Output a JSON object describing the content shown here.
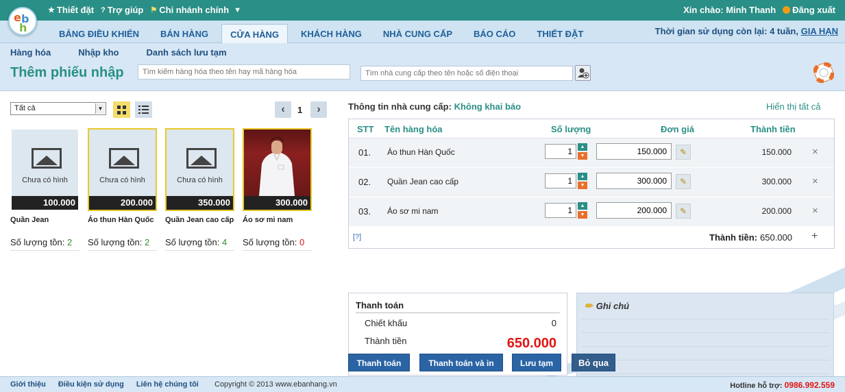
{
  "top": {
    "settings": "Thiết đặt",
    "help": "Trợ giúp",
    "branch": "Chi nhánh chính",
    "greeting": "Xin chào: Minh Thanh",
    "logout": "Đăng xuất"
  },
  "nav": {
    "tabs": [
      "BẢNG ĐIỀU KHIỂN",
      "BÁN HÀNG",
      "CỬA HÀNG",
      "KHÁCH HÀNG",
      "NHÀ CUNG CẤP",
      "BÁO CÁO",
      "THIẾT ĐẶT"
    ],
    "active_tab": "CỬA HÀNG",
    "time_left": "Thời gian sử dụng còn lại: 4 tuần,",
    "extend": "GIA HẠN"
  },
  "sub": {
    "links": [
      "Hàng hóa",
      "Nhập kho",
      "Danh sách lưu tạm"
    ],
    "title": "Thêm phiếu nhập",
    "search_product_placeholder": "Tìm kiếm hàng hóa theo tên hay mã hàng hóa",
    "search_supplier_placeholder": "Tìm nhà cung cấp theo tên hoặc số điện thoại"
  },
  "left": {
    "filter": "Tất cả",
    "page": "1",
    "stock_label": "Số lượng tồn:",
    "no_image": "Chưa có hình",
    "products": [
      {
        "name": "Quần Jean",
        "price": "100.000",
        "stock": "2"
      },
      {
        "name": "Áo thun Hàn Quốc",
        "price": "200.000",
        "stock": "2"
      },
      {
        "name": "Quần Jean cao cấp",
        "price": "350.000",
        "stock": "4"
      },
      {
        "name": "Áo sơ mi nam",
        "price": "300.000",
        "stock": "0"
      }
    ]
  },
  "right": {
    "supplier_label": "Thông tin nhà cung cấp:",
    "supplier_value": "Không khai báo",
    "show_all": "Hiển thị tất cả",
    "columns": {
      "stt": "STT",
      "name": "Tên hàng hóa",
      "qty": "Số lượng",
      "price": "Đơn giá",
      "total": "Thành tiền"
    },
    "rows": [
      {
        "stt": "01.",
        "name": "Áo thun Hàn Quốc",
        "qty": "1",
        "price": "150.000",
        "total": "150.000"
      },
      {
        "stt": "02.",
        "name": "Quần Jean cao cấp",
        "qty": "1",
        "price": "300.000",
        "total": "300.000"
      },
      {
        "stt": "03.",
        "name": "Áo sơ mi nam",
        "qty": "1",
        "price": "200.000",
        "total": "200.000"
      }
    ],
    "help": "[?]",
    "sum_label": "Thành tiền:",
    "sum_value": "650.000"
  },
  "payment": {
    "title": "Thanh toán",
    "discount_label": "Chiết khấu",
    "discount_value": "0",
    "total_label": "Thành tiền",
    "total_value": "650.000"
  },
  "note": {
    "title": "Ghi chú"
  },
  "buttons": {
    "pay": "Thanh toán",
    "pay_print": "Thanh toán và in",
    "save": "Lưu tạm",
    "skip": "Bỏ qua"
  },
  "footer": {
    "links": [
      "Giới thiệu",
      "Điều kiện sử dụng",
      "Liên hệ chúng tôi"
    ],
    "copyright": "Copyright © 2013 www.ebanhang.vn",
    "hotline_label": "Hotline hỗ trợ:",
    "hotline": "0986.992.559"
  },
  "colors": {
    "brand": "#2a8f86",
    "nav_text": "#1f5f99",
    "price_red": "#e21414",
    "stock_green": "#2e8f2e",
    "button": "#2a64a4"
  }
}
